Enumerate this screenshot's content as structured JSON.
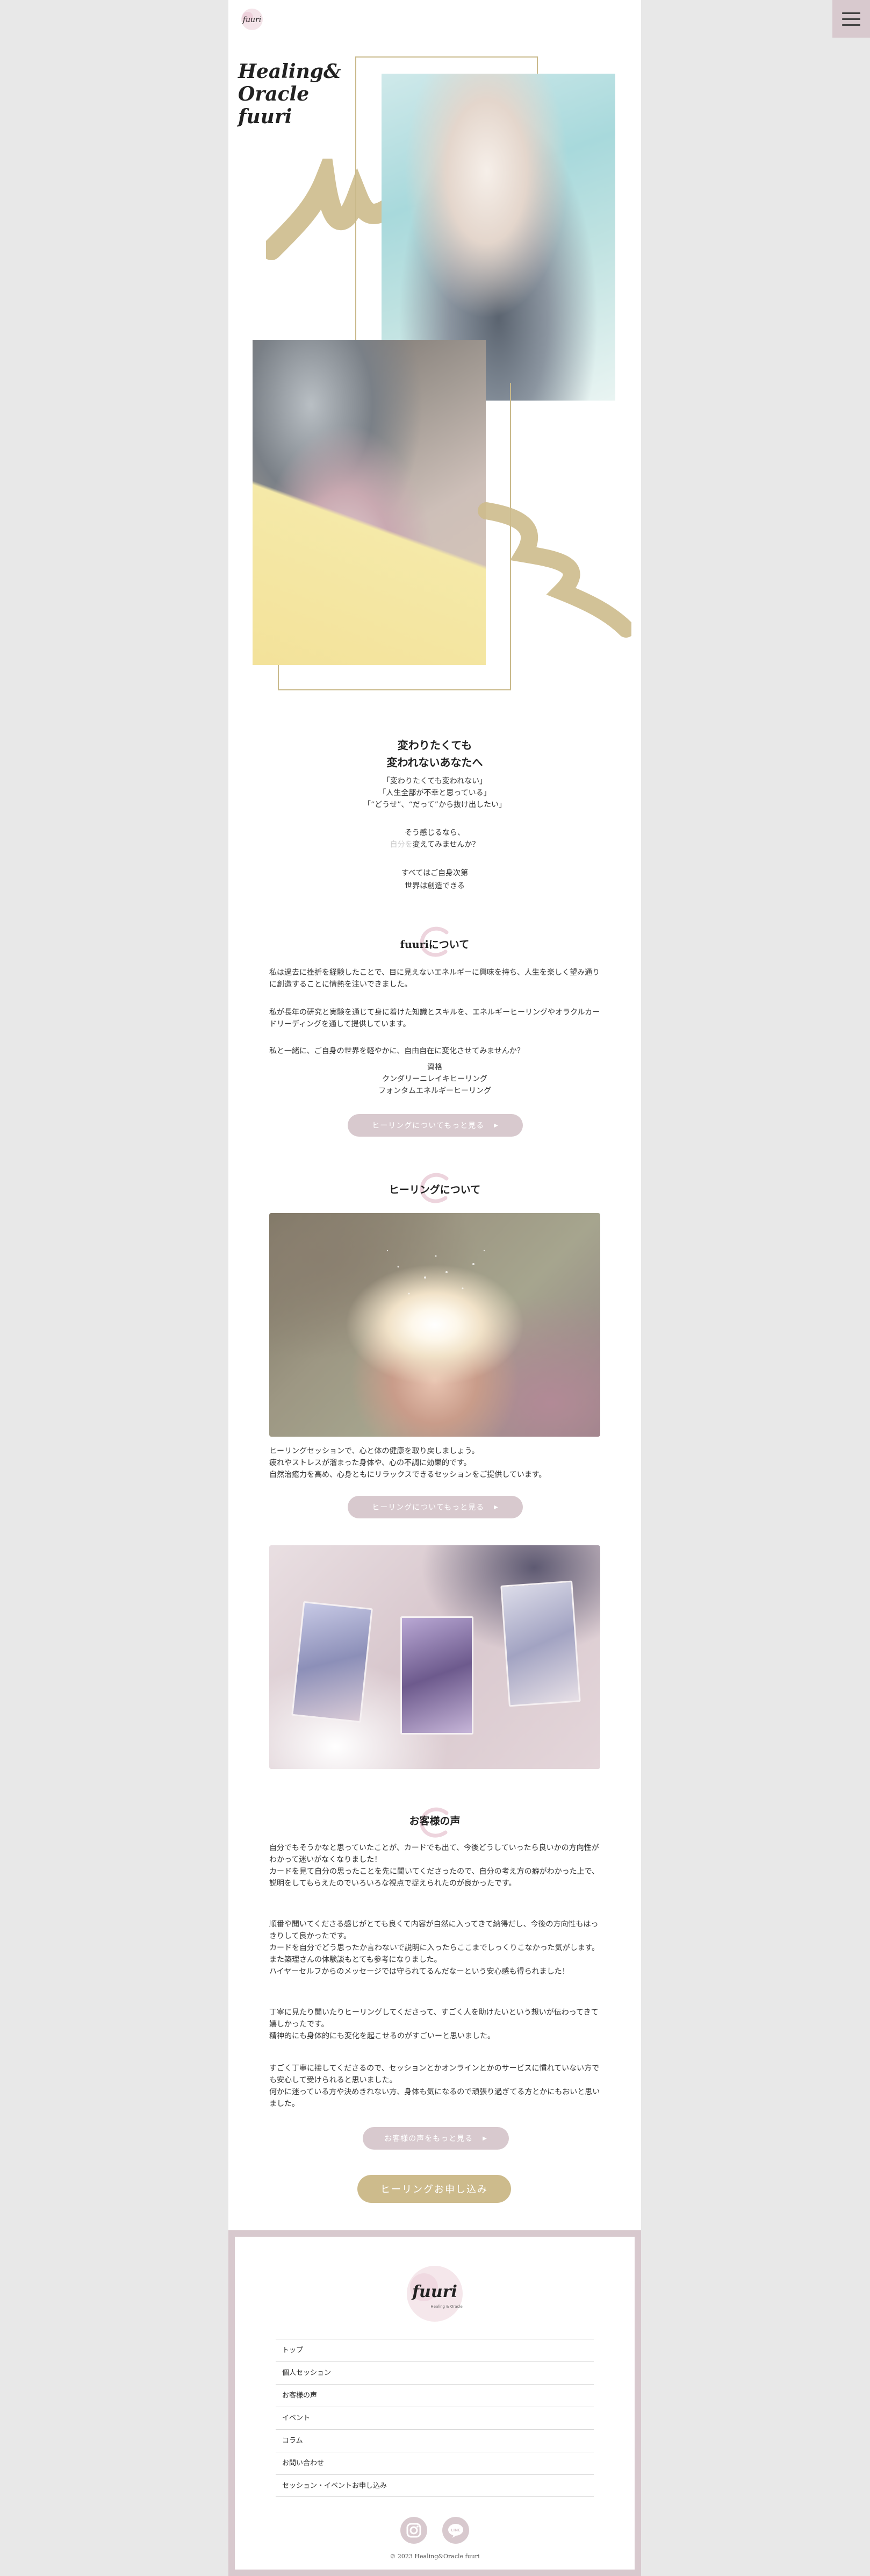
{
  "header": {
    "logo_text": "fuuri",
    "menu_icon": "hamburger-menu-icon"
  },
  "hero": {
    "title": "Healing&\nOracle\nfuuri"
  },
  "intro": {
    "heading_line1": "変わりたくても",
    "heading_line2": "変われないあなたへ",
    "line1": "「変わりたくても変われない」",
    "line2": "「人生全部が不幸と思っている」",
    "line3": "「“どうせ”、“だって”から抜け出したい」",
    "line4": "そう感じるなら、",
    "line5_faded": "自分を",
    "line5": "変えてみませんか？",
    "line6": "すべてはご自身次第",
    "line7": "世界は創造できる"
  },
  "about": {
    "title": "fuuriについて",
    "para1": "私は過去に挫折を経験したことで、目に見えないエネルギーに興味を持ち、人生を楽しく望み通りに創造することに情熱を注いできました。",
    "para2": "私が長年の研究と実験を通じて身に着けた知識とスキルを、エネルギーヒーリングやオラクルカードリーディングを通して提供しています。",
    "para3": "私と一緒に、ご自身の世界を軽やかに、自由自在に変化させてみませんか？",
    "cert_heading": "資格",
    "cert1": "クンダリーニレイキヒーリング",
    "cert2": "フォンタムエネルギーヒーリング",
    "button": "ヒーリングについてもっと見る"
  },
  "healing": {
    "title": "ヒーリングについて",
    "para_line1": "ヒーリングセッションで、心と体の健康を取り戻しましょう。",
    "para_line2": "疲れやストレスが溜まった身体や、心の不調に効果的です。",
    "para_line3": "自然治癒力を高め、心身ともにリラックスできるセッションをご提供しています。",
    "button": "ヒーリングについてもっと見る"
  },
  "voices": {
    "title": "お客様の声",
    "para1": "自分でもそうかなと思っていたことが、カードでも出て、今後どうしていったら良いかの方向性がわかって迷いがなくなりました！\nカードを見て自分の思ったことを先に聞いてくださったので、自分の考え方の癖がわかった上で、説明をしてもらえたのでいろいろな視点で捉えられたのが良かったです。",
    "para2": "順番や聞いてくださる感じがとても良くて内容が自然に入ってきて納得だし、今後の方向性もはっきりして良かったです。\nカードを自分でどう思ったか言わないで説明に入ったらここまでしっくりこなかった気がします。また築理さんの体験談もとても参考になりました。\nハイヤーセルフからのメッセージでは守られてるんだなーという安心感も得られました！",
    "para3": "丁寧に見たり聞いたりヒーリングしてくださって、すごく人を助けたいという想いが伝わってきて嬉しかったです。\n精神的にも身体的にも変化を起こせるのがすごいーと思いました。",
    "para4": "すごく丁寧に接してくださるので、セッションとかオンラインとかのサービスに慣れていない方でも安心して受けられると思いました。\n何かに迷っている方や決めきれない方、身体も気になるので頑張り過ぎてる方とかにもおいと思いました。",
    "button": "お客様の声をもっと見る",
    "apply_button": "ヒーリングお申し込み"
  },
  "footer": {
    "logo_text": "fuuri",
    "logo_sub": "Healing & Oracle",
    "nav": [
      "トップ",
      "個人セッション",
      "お客様の声",
      "イベント",
      "コラム",
      "お問い合わせ",
      "セッション・イベントお申し込み"
    ],
    "social": [
      "instagram-icon",
      "line-icon"
    ],
    "copyright": "© 2023 Healing&Oracle fuuri"
  },
  "colors": {
    "accent_pink": "#d8c9ce",
    "accent_gold": "#cdbb8c",
    "frame_gold": "#c9b98a"
  }
}
